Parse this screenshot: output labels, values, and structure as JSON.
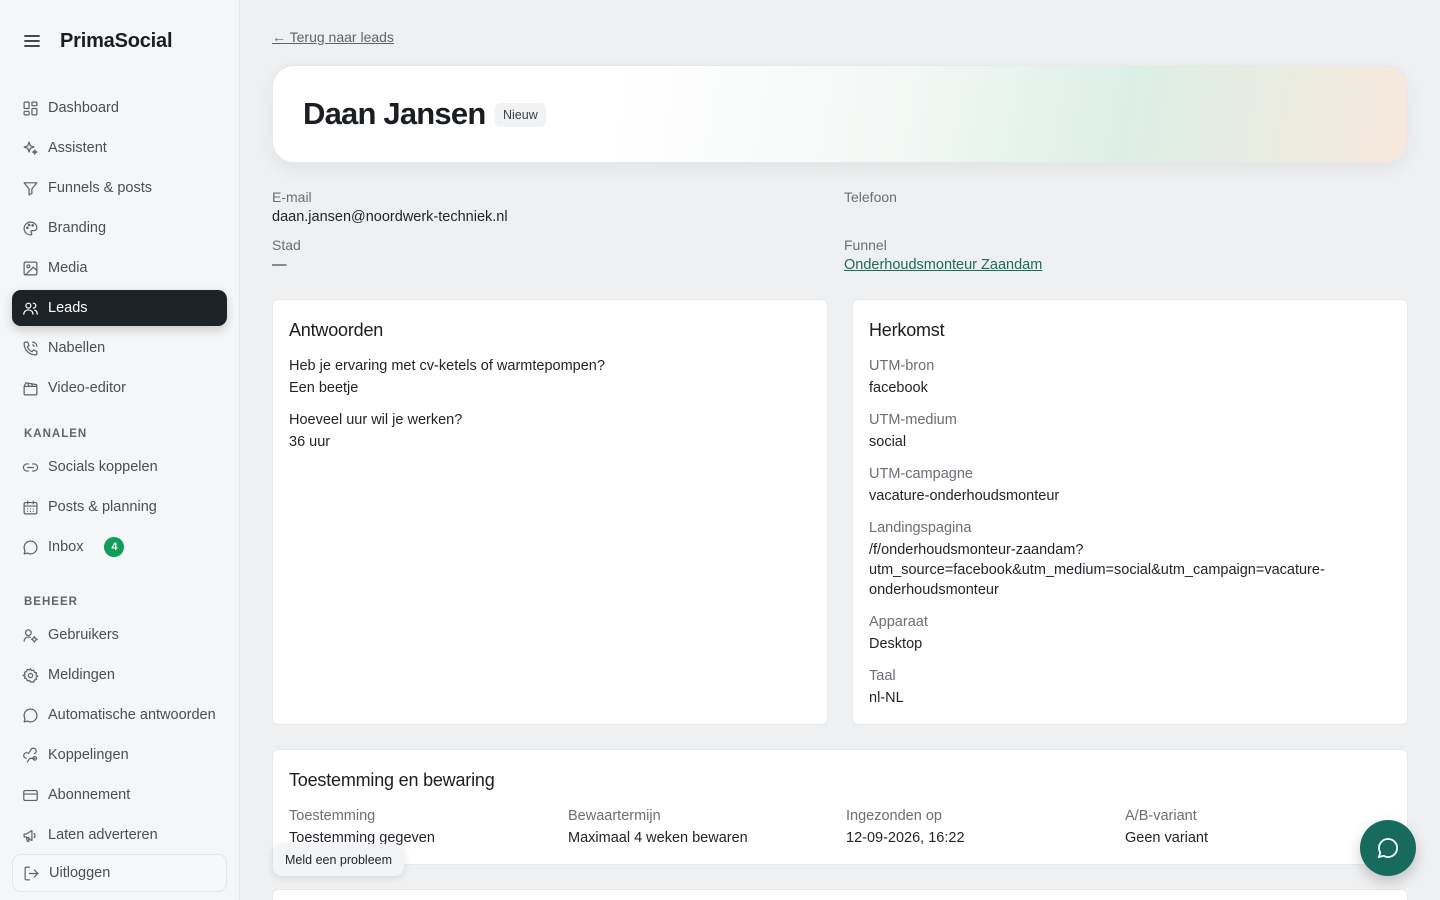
{
  "app": {
    "name": "PrimaSocial"
  },
  "sidebar": {
    "items": [
      {
        "label": "Dashboard",
        "icon": "grid-icon"
      },
      {
        "label": "Assistent",
        "icon": "sparkle-icon"
      },
      {
        "label": "Funnels & posts",
        "icon": "funnel-icon"
      },
      {
        "label": "Branding",
        "icon": "palette-icon"
      },
      {
        "label": "Media",
        "icon": "image-icon"
      },
      {
        "label": "Leads",
        "icon": "users-icon",
        "active": true
      },
      {
        "label": "Nabellen",
        "icon": "phone-icon"
      },
      {
        "label": "Video-editor",
        "icon": "clapperboard-icon"
      }
    ],
    "kanalen_title": "KANALEN",
    "kanalen": [
      {
        "label": "Socials koppelen",
        "icon": "link-icon"
      },
      {
        "label": "Posts & planning",
        "icon": "calendar-icon"
      },
      {
        "label": "Inbox",
        "icon": "chat-bubble-icon",
        "badge": "4"
      }
    ],
    "beheer_title": "BEHEER",
    "beheer": [
      {
        "label": "Gebruikers",
        "icon": "user-gear-icon"
      },
      {
        "label": "Meldingen",
        "icon": "gear-icon"
      },
      {
        "label": "Automatische antwoorden",
        "icon": "chat-bubble-icon"
      },
      {
        "label": "Koppelingen",
        "icon": "webhook-icon"
      },
      {
        "label": "Abonnement",
        "icon": "credit-card-icon"
      },
      {
        "label": "Laten adverteren",
        "icon": "megaphone-icon"
      }
    ],
    "logout": "Uitloggen"
  },
  "main": {
    "back_link": "← Terug naar leads",
    "lead": {
      "name": "Daan Jansen",
      "status": "Nieuw"
    },
    "info": {
      "email_label": "E-mail",
      "email_value": "daan.jansen@noordwerk-techniek.nl",
      "phone_label": "Telefoon",
      "city_label": "Stad",
      "city_value": "—",
      "funnel_label": "Funnel",
      "funnel_value": "Onderhoudsmonteur Zaandam"
    },
    "answers": {
      "title": "Antwoorden",
      "items": [
        {
          "question": "Heb je ervaring met cv-ketels of warmtepompen?",
          "answer": "Een beetje"
        },
        {
          "question": "Hoeveel uur wil je werken?",
          "answer": "36 uur"
        }
      ]
    },
    "origin": {
      "title": "Herkomst",
      "fields": [
        {
          "label": "UTM-bron",
          "value": "facebook"
        },
        {
          "label": "UTM-medium",
          "value": "social"
        },
        {
          "label": "UTM-campagne",
          "value": "vacature-onderhoudsmonteur"
        },
        {
          "label": "Landingspagina",
          "value_lines": [
            "/f/onderhoudsmonteur-zaandam?",
            "utm_source=facebook&utm_medium=social&utm_campaign=vacature-",
            "onderhoudsmonteur"
          ]
        },
        {
          "label": "Apparaat",
          "value": "Desktop"
        },
        {
          "label": "Taal",
          "value": "nl-NL"
        }
      ]
    },
    "consent": {
      "title": "Toestemming en bewaring",
      "fields": [
        {
          "label": "Toestemming",
          "value": "Toestemming gegeven"
        },
        {
          "label": "Bewaartermijn",
          "value": "Maximaal 4 weken bewaren"
        },
        {
          "label": "Ingezonden op",
          "value": "12-09-2026, 16:22"
        },
        {
          "label": "A/B-variant",
          "value": "Geen variant"
        }
      ]
    },
    "report_button": "Meld een probleem"
  },
  "colors": {
    "accent": "#176b5d",
    "active_nav": "#1d2226",
    "badge": "#0f9d58"
  }
}
